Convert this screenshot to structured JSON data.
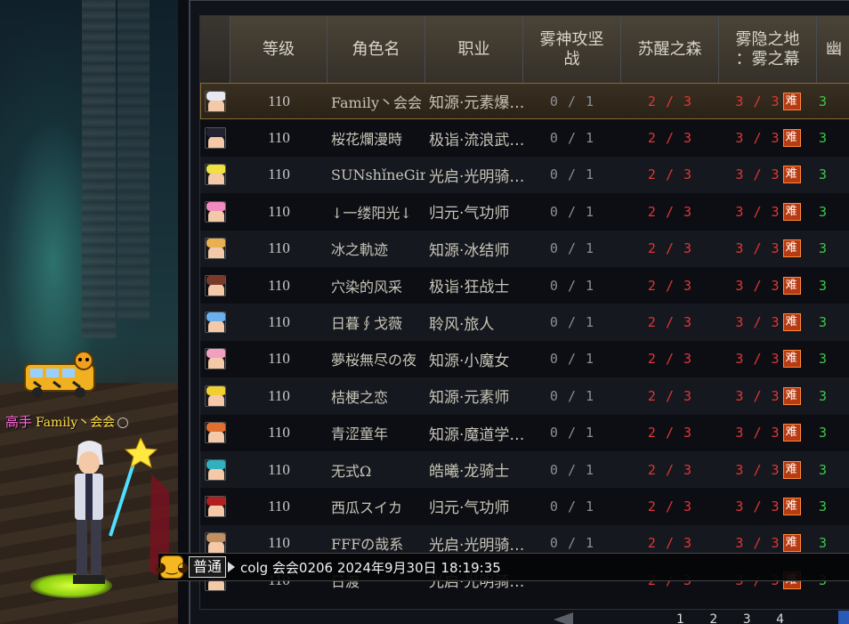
{
  "player": {
    "title": "高手",
    "name": "Family丶会会"
  },
  "table": {
    "headers": [
      "",
      "等级",
      "角色名",
      "职业",
      "雾神攻坚战",
      "苏醒之森",
      "雾隐之地：雾之幕",
      "幽"
    ],
    "header_lines": {
      "c4": [
        "雾神攻坚",
        "战"
      ],
      "c6": [
        "雾隐之地",
        "：雾之幕"
      ]
    },
    "hard_label": "难",
    "rows": [
      {
        "level": "110",
        "name": "Family丶会会",
        "job": "知源·元素爆…",
        "s1": "0 / 1",
        "s2": "2 / 3",
        "s3": "3 / 3",
        "s4": "3",
        "hair": "#e8e8f0"
      },
      {
        "level": "110",
        "name": "桜花爛漫時",
        "job": "极诣·流浪武…",
        "s1": "0 / 1",
        "s2": "2 / 3",
        "s3": "3 / 3",
        "s4": "3",
        "hair": "#222230"
      },
      {
        "level": "110",
        "name": "SUNshǐneGir",
        "job": "光启·光明骑…",
        "s1": "0 / 1",
        "s2": "2 / 3",
        "s3": "3 / 3",
        "s4": "3",
        "hair": "#f0e040"
      },
      {
        "level": "110",
        "name": "↓一缕阳光↓",
        "job": "归元·气功师",
        "s1": "0 / 1",
        "s2": "2 / 3",
        "s3": "3 / 3",
        "s4": "3",
        "hair": "#f08ac0"
      },
      {
        "level": "110",
        "name": "冰之軌迹",
        "job": "知源·冰结师",
        "s1": "0 / 1",
        "s2": "2 / 3",
        "s3": "3 / 3",
        "s4": "3",
        "hair": "#e8b050"
      },
      {
        "level": "110",
        "name": "穴染的风采",
        "job": "极诣·狂战士",
        "s1": "0 / 1",
        "s2": "2 / 3",
        "s3": "3 / 3",
        "s4": "3",
        "hair": "#7a3a2a"
      },
      {
        "level": "110",
        "name": "日暮∮戈薇",
        "job": "聆风·旅人",
        "s1": "0 / 1",
        "s2": "2 / 3",
        "s3": "3 / 3",
        "s4": "3",
        "hair": "#6ab0f0"
      },
      {
        "level": "110",
        "name": "夢桜無尽の夜",
        "job": "知源·小魔女",
        "s1": "0 / 1",
        "s2": "2 / 3",
        "s3": "3 / 3",
        "s4": "3",
        "hair": "#f0a0c0"
      },
      {
        "level": "110",
        "name": "桔梗之恋",
        "job": "知源·元素师",
        "s1": "0 / 1",
        "s2": "2 / 3",
        "s3": "3 / 3",
        "s4": "3",
        "hair": "#f0d030"
      },
      {
        "level": "110",
        "name": "青涩童年",
        "job": "知源·魔道学…",
        "s1": "0 / 1",
        "s2": "2 / 3",
        "s3": "3 / 3",
        "s4": "3",
        "hair": "#e07030"
      },
      {
        "level": "110",
        "name": "无式Ω",
        "job": "皓曦·龙骑士",
        "s1": "0 / 1",
        "s2": "2 / 3",
        "s3": "3 / 3",
        "s4": "3",
        "hair": "#30b0c0"
      },
      {
        "level": "110",
        "name": "西瓜スイカ",
        "job": "归元·气功师",
        "s1": "0 / 1",
        "s2": "2 / 3",
        "s3": "3 / 3",
        "s4": "3",
        "hair": "#b02020"
      },
      {
        "level": "110",
        "name": "FFFの哉系",
        "job": "光启·光明骑…",
        "s1": "0 / 1",
        "s2": "2 / 3",
        "s3": "3 / 3",
        "s4": "3",
        "hair": "#c09060"
      },
      {
        "level": "110",
        "name": "日渡",
        "job": "光启·光明骑…",
        "s1": "",
        "s2": "2 / 3",
        "s3": "3 / 3",
        "s4": "3",
        "hair": "#a0a0a0"
      }
    ]
  },
  "chat": {
    "channel": "普通",
    "message": "colg 会会0206 2024年9月30日 18:19:35"
  },
  "pager": {
    "pages": "1 2 3 4"
  },
  "colors": {
    "accent_red": "#e13636",
    "accent_green": "#3cc94a",
    "gold": "#ffe04a",
    "title_pink": "#ff6ad8"
  }
}
